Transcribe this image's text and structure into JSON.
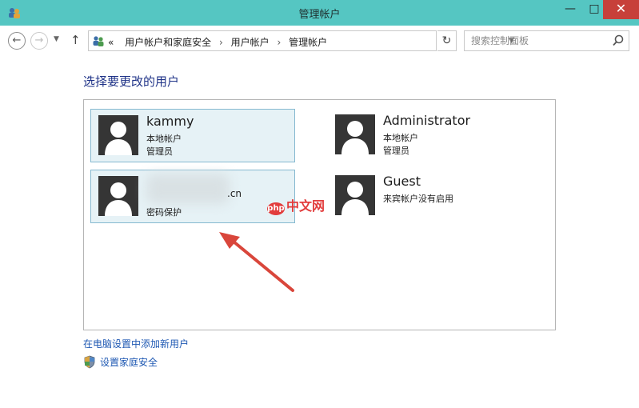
{
  "window": {
    "title": "管理帐户",
    "controls": {
      "minimize": "—",
      "maximize": "□",
      "close": "✕"
    }
  },
  "address_bar": {
    "breadcrumb_prefix": "«",
    "breadcrumbs": [
      "用户帐户和家庭安全",
      "用户帐户",
      "管理帐户"
    ],
    "separator": "›",
    "search_placeholder": "搜索控制面板"
  },
  "main": {
    "heading": "选择要更改的用户",
    "accounts": [
      {
        "name": "kammy",
        "line1": "本地帐户",
        "line2": "管理员",
        "selected": true
      },
      {
        "name": "Administrator",
        "line1": "本地帐户",
        "line2": "管理员",
        "selected": false
      },
      {
        "name_suffix": ".cn",
        "line2": "密码保护",
        "selected": true,
        "name_obscured": true
      },
      {
        "name": "Guest",
        "line1": "来宾帐户没有启用",
        "selected": false
      }
    ],
    "links": {
      "add_user": "在电脑设置中添加新用户",
      "family_safety": "设置家庭安全"
    }
  },
  "watermark": {
    "badge": "php",
    "text": "中文网"
  },
  "colors": {
    "titlebar": "#55c6c2",
    "close_button": "#c7403a",
    "heading": "#1e3287",
    "link": "#1f59b3",
    "selected_tile": "#e6f2f6",
    "annotation_arrow": "#d9463b"
  },
  "icons": {
    "app": "users-control-panel-icon",
    "address": "users-control-panel-icon",
    "search": "magnifier-icon",
    "refresh": "refresh-icon",
    "avatar": "user-silhouette-icon",
    "family": "shield-icon"
  }
}
